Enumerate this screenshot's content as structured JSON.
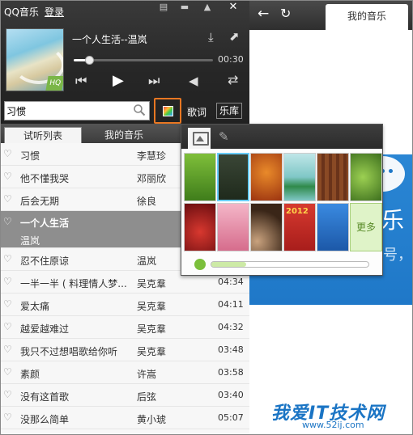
{
  "app": {
    "title": "QQ音乐",
    "login": "登录"
  },
  "player": {
    "now_playing": "一个人生活--温岚",
    "time": "00:30",
    "progress": 0.11,
    "cover_badge": "HQ"
  },
  "search": {
    "value": "习惯"
  },
  "toolbar": {
    "lyrics": "歌词",
    "library": "乐库"
  },
  "tabs": {
    "trial": "试听列表",
    "mine": "我的音乐"
  },
  "songs": [
    {
      "title": "习惯",
      "artist": "李慧珍",
      "duration": ""
    },
    {
      "title": "他不懂我哭",
      "artist": "邓丽欣",
      "duration": ""
    },
    {
      "title": "后会无期",
      "artist": "徐良",
      "duration": ""
    },
    {
      "title": "一个人生活",
      "artist": "",
      "duration": "",
      "subtitle": "温岚"
    },
    {
      "title": "忍不住原谅",
      "artist": "温岚",
      "duration": ""
    },
    {
      "title": "一半一半 ( 料理情人梦...",
      "artist": "吴克羣",
      "duration": "04:34"
    },
    {
      "title": "爱太痛",
      "artist": "吴克羣",
      "duration": "04:11"
    },
    {
      "title": "越爱越难过",
      "artist": "吴克羣",
      "duration": "04:32"
    },
    {
      "title": "我只不过想唱歌给你听",
      "artist": "吴克羣",
      "duration": "03:48"
    },
    {
      "title": "素颜",
      "artist": "许嵩",
      "duration": "03:58"
    },
    {
      "title": "没有这首歌",
      "artist": "后弦",
      "duration": "03:40"
    },
    {
      "title": "没那么简单",
      "artist": "黄小琥",
      "duration": "05:07"
    }
  ],
  "right": {
    "tab": "我的音乐",
    "banner_text": "乐",
    "banner_sub": "号，",
    "watermark": "我爱IT技术网",
    "watermark_url": "www.52ij.com"
  },
  "skin_popup": {
    "more": "更多",
    "opacity": 0.22,
    "swatches": [
      "#5a9a2e",
      "#2d3a2a",
      "#c2541a",
      "#7fc7c6",
      "#7a3f20",
      "#6f9f36",
      "#a8201e",
      "#e58aa6",
      "#6a5240",
      "#c8302a",
      "#2a6fc2"
    ],
    "swatch_2012": "2012"
  },
  "icons": {
    "close": "close-icon",
    "minimize": "minimize-icon",
    "menu": "menu-icon",
    "heart": "heart-icon"
  }
}
